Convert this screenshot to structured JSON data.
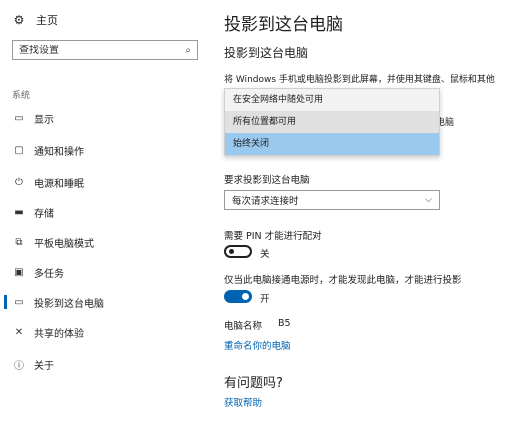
{
  "sidebar": {
    "home_label": "主页",
    "search_placeholder": "查找设置",
    "section_label": "系统",
    "items": [
      {
        "label": "显示",
        "icon": "monitor-icon"
      },
      {
        "label": "通知和操作",
        "icon": "notification-icon"
      },
      {
        "label": "电源和睡眠",
        "icon": "power-icon"
      },
      {
        "label": "存储",
        "icon": "storage-icon"
      },
      {
        "label": "平板电脑模式",
        "icon": "tablet-mode-icon"
      },
      {
        "label": "多任务",
        "icon": "multitasking-icon"
      },
      {
        "label": "投影到这台电脑",
        "icon": "project-icon",
        "active": true
      },
      {
        "label": "共享的体验",
        "icon": "shared-experiences-icon"
      },
      {
        "label": "关于",
        "icon": "info-icon"
      }
    ]
  },
  "main": {
    "page_title": "投影到这台电脑",
    "subtitle": "投影到这台电脑",
    "description": "将 Windows 手机或电脑投影到此屏幕，并使用其键盘、鼠标和其他",
    "behind_text": "电脑",
    "dropdown_options": [
      "在安全网络中随处可用",
      "所有位置都可用",
      "始终关闭"
    ],
    "dropdown_selected_index": 2,
    "ask_label": "要求投影到这台电脑",
    "ask_value": "每次请求连接时",
    "pin_label": "需要 PIN 才能进行配对",
    "pin_state": "关",
    "power_label": "仅当此电脑接通电源时，才能发现此电脑，才能进行投影",
    "power_state": "开",
    "pc_name_label": "电脑名称",
    "pc_name_value": "B5",
    "rename_link": "重命名你的电脑",
    "question_heading": "有问题吗?",
    "help_link": "获取帮助"
  },
  "colors": {
    "accent": "#0063b1",
    "selected_option": "#99c9ef"
  }
}
